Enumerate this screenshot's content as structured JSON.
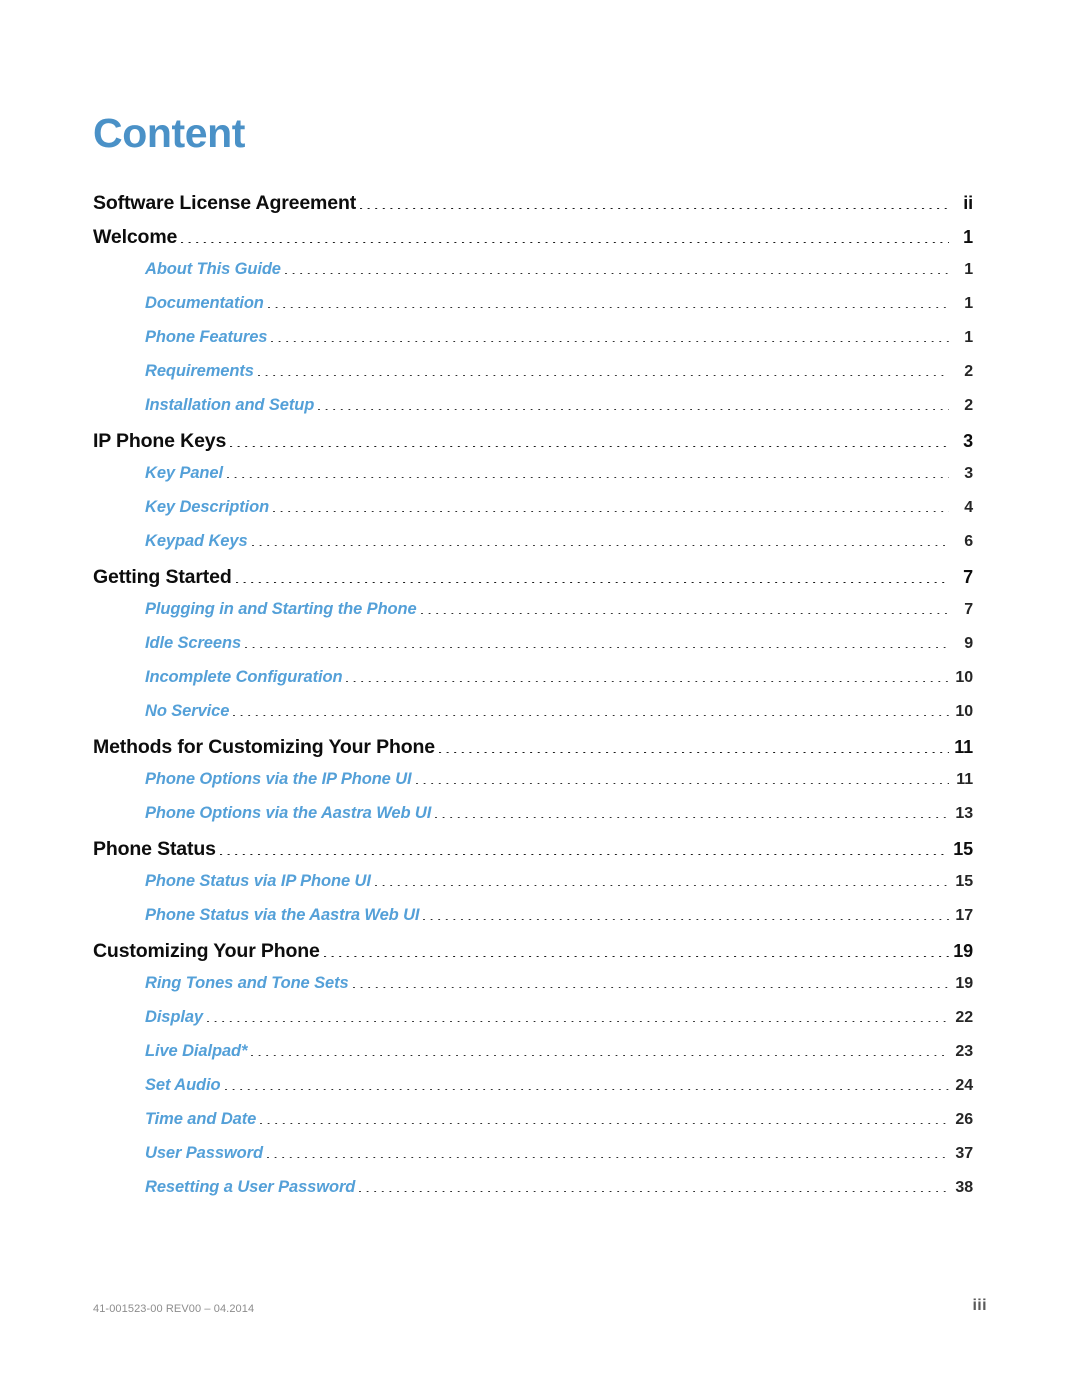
{
  "document": {
    "title": "Content",
    "title_color": "#4a91c7",
    "level2_color": "#54a0d8"
  },
  "toc": {
    "entries": [
      {
        "level": 1,
        "title": "Software License Agreement",
        "page": "ii"
      },
      {
        "level": 1,
        "title": "Welcome",
        "page": "1"
      },
      {
        "level": 2,
        "title": "About This Guide",
        "page": "1"
      },
      {
        "level": 2,
        "title": "Documentation",
        "page": "1"
      },
      {
        "level": 2,
        "title": "Phone Features",
        "page": "1"
      },
      {
        "level": 2,
        "title": "Requirements",
        "page": "2"
      },
      {
        "level": 2,
        "title": "Installation and Setup",
        "page": "2"
      },
      {
        "level": 1,
        "title": "IP Phone Keys",
        "page": "3"
      },
      {
        "level": 2,
        "title": "Key Panel",
        "page": "3"
      },
      {
        "level": 2,
        "title": "Key Description",
        "page": "4"
      },
      {
        "level": 2,
        "title": "Keypad Keys",
        "page": "6"
      },
      {
        "level": 1,
        "title": "Getting Started",
        "page": "7"
      },
      {
        "level": 2,
        "title": "Plugging in and Starting the Phone",
        "page": "7"
      },
      {
        "level": 2,
        "title": "Idle Screens",
        "page": "9"
      },
      {
        "level": 2,
        "title": "Incomplete Configuration",
        "page": "10"
      },
      {
        "level": 2,
        "title": "No Service",
        "page": "10"
      },
      {
        "level": 1,
        "title": "Methods for Customizing Your Phone",
        "page": "11"
      },
      {
        "level": 2,
        "title": "Phone Options via the IP Phone UI",
        "page": "11"
      },
      {
        "level": 2,
        "title": "Phone Options via the Aastra Web UI",
        "page": "13"
      },
      {
        "level": 1,
        "title": "Phone Status",
        "page": "15"
      },
      {
        "level": 2,
        "title": "Phone Status via IP Phone UI",
        "page": "15"
      },
      {
        "level": 2,
        "title": "Phone Status via the Aastra Web UI",
        "page": "17"
      },
      {
        "level": 1,
        "title": "Customizing Your Phone",
        "page": "19"
      },
      {
        "level": 2,
        "title": "Ring Tones and Tone Sets",
        "page": "19"
      },
      {
        "level": 2,
        "title": "Display",
        "page": "22"
      },
      {
        "level": 2,
        "title": "Live Dialpad*",
        "page": "23"
      },
      {
        "level": 2,
        "title": "Set Audio",
        "page": "24"
      },
      {
        "level": 2,
        "title": "Time and Date",
        "page": "26"
      },
      {
        "level": 2,
        "title": "User Password",
        "page": "37"
      },
      {
        "level": 2,
        "title": "Resetting a User Password",
        "page": "38"
      }
    ]
  },
  "footer": {
    "doc_id": "41-001523-00 REV00 – 04.2014",
    "page_number": "iii"
  }
}
